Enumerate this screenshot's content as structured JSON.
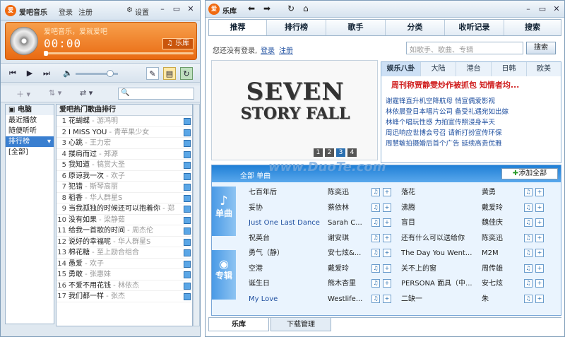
{
  "player": {
    "title": "爱吧音乐",
    "menu": [
      "登录",
      "注册"
    ],
    "settings": "设置",
    "now_playing": "爱吧音乐，爱就爱吧",
    "time": "00:00",
    "library_btn": "乐库",
    "search_placeholder": "",
    "categories": [
      {
        "label": "电脑",
        "selected": false,
        "header": true
      },
      {
        "label": "最近播放",
        "selected": false
      },
      {
        "label": "随便听听",
        "selected": false
      },
      {
        "label": "排行榜",
        "selected": true
      },
      {
        "label": "[全部]",
        "selected": false
      }
    ],
    "list_title": "爱吧热门歌曲排行",
    "songs": [
      {
        "n": "1",
        "title": "花蝴蝶",
        "artist": "游鸿明"
      },
      {
        "n": "2",
        "title": "I MISS YOU",
        "artist": "青苹果少女"
      },
      {
        "n": "3",
        "title": "心跳",
        "artist": "王力宏"
      },
      {
        "n": "4",
        "title": "搂肩而过",
        "artist": "郑源"
      },
      {
        "n": "5",
        "title": "我知道",
        "artist": "犒赏大圣"
      },
      {
        "n": "6",
        "title": "原谅我一次",
        "artist": "欢子"
      },
      {
        "n": "7",
        "title": "犯错",
        "artist": "斯琴高丽"
      },
      {
        "n": "8",
        "title": "稻香",
        "artist": "华人群星S"
      },
      {
        "n": "9",
        "title": "当我孤独的时候还可以抱着你",
        "artist": "郑"
      },
      {
        "n": "10",
        "title": "没有如果",
        "artist": "梁静茹"
      },
      {
        "n": "11",
        "title": "给我一首歌的时间",
        "artist": "周杰伦"
      },
      {
        "n": "12",
        "title": "说好的幸福呢",
        "artist": "华人群星S"
      },
      {
        "n": "13",
        "title": "棉花糖",
        "artist": "至上励合组合"
      },
      {
        "n": "14",
        "title": "愚爱",
        "artist": "欢子"
      },
      {
        "n": "15",
        "title": "勇敢",
        "artist": "张惠妹"
      },
      {
        "n": "16",
        "title": "不爱不用花钱",
        "artist": "林依杰"
      },
      {
        "n": "17",
        "title": "我们都一样",
        "artist": "张杰"
      }
    ]
  },
  "library": {
    "title": "乐库",
    "tabs": [
      "推荐",
      "排行榜",
      "歌手",
      "分类",
      "收听记录",
      "搜索"
    ],
    "login_prompt": "您还没有登录,",
    "login_link": "登录",
    "register_link": "注册",
    "search_placeholder": "如歌手、歌曲、专辑",
    "search_btn": "搜索",
    "banner_line1": "SEVEN",
    "banner_line2": "STORY FALL",
    "banner_pages": [
      "1",
      "2",
      "3",
      "4"
    ],
    "news_tabs": [
      "娱乐八卦",
      "大陆",
      "港台",
      "日韩",
      "欧美"
    ],
    "news_headline": "周刊称贾静雯炒作被抓包 知情者均...",
    "news_items": [
      "谢霆锋直升机空降航母  悄宣偶爱影视",
      "林依晨登日本唱片公司  备受礼遇宛如出嫁",
      "林峰个唱玩性感  为拍宣传照浸身半天",
      "周迅响应世博会号召  请新打扮宣传环保",
      "周慧敏拍摄婚后首个广告  延续高贵优雅"
    ],
    "rec_title": "全部  单曲",
    "add_all": "添加全部",
    "single_label": "单曲",
    "album_label": "专辑",
    "rows": [
      {
        "song": "七百年后",
        "artist": "陈奕迅",
        "song2": "落花",
        "artist2": "黄勇"
      },
      {
        "song": "妥协",
        "artist": "蔡依林",
        "song2": "沸腾",
        "artist2": "戴爱玲"
      },
      {
        "song": "Just One Last Dance",
        "artist": "Sarah C...",
        "song2": "盲目",
        "artist2": "魏佳庆"
      },
      {
        "song": "祝英台",
        "artist": "谢安琪",
        "song2": "还有什么可以送给你",
        "artist2": "陈奕迅"
      },
      {
        "song": "勇气（静）",
        "artist": "安七炫&...",
        "song2": "The Day You Went...",
        "artist2": "M2M"
      },
      {
        "song": "空港",
        "artist": "戴爱玲",
        "song2": "关不上的窗",
        "artist2": "周传雄"
      },
      {
        "song": "诞生日",
        "artist": "熊木杏里",
        "song2": "PERSONA 面具（中...",
        "artist2": "安七炫"
      },
      {
        "song": "My Love",
        "artist": "Westlife...",
        "song2": "二缺一",
        "artist2": "朱"
      }
    ],
    "bottom_tabs": [
      "乐库",
      "下载管理"
    ],
    "watermark": "www.DuoTe.com"
  },
  "colors": {
    "accent": "#f06a10",
    "blue": "#1f7fd6",
    "select": "#3a7fd0"
  }
}
